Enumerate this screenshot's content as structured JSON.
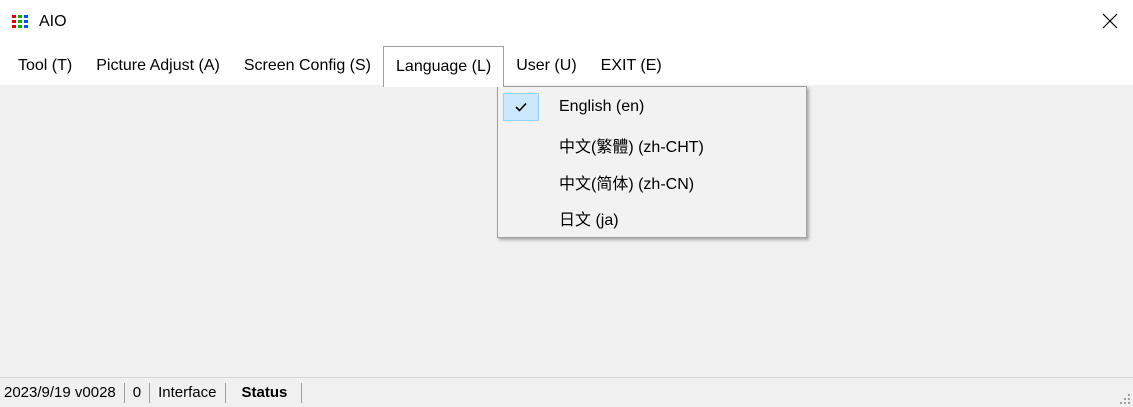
{
  "window": {
    "title": "AIO",
    "icon": "rgb-grid-icon",
    "icon_colors": [
      "#e00000",
      "#00b000",
      "#0050ff"
    ]
  },
  "menubar": {
    "items": [
      {
        "label": "Tool (T)"
      },
      {
        "label": "Picture Adjust (A)"
      },
      {
        "label": "Screen Config (S)"
      },
      {
        "label": "Language (L)",
        "open": true
      },
      {
        "label": "User (U)"
      },
      {
        "label": "EXIT (E)"
      }
    ]
  },
  "language_menu": {
    "items": [
      {
        "label": "English (en)",
        "checked": true
      },
      {
        "label": "中文(繁體) (zh-CHT)",
        "checked": false
      },
      {
        "label": "中文(简体) (zh-CN)",
        "checked": false
      },
      {
        "label": "日文 (ja)",
        "checked": false
      }
    ]
  },
  "statusbar": {
    "version": "2023/9/19 v0028",
    "count": "0",
    "interface": "Interface",
    "status": "Status"
  },
  "colors": {
    "check_highlight": "#cce8ff",
    "window_bg": "#f0f0f0"
  }
}
